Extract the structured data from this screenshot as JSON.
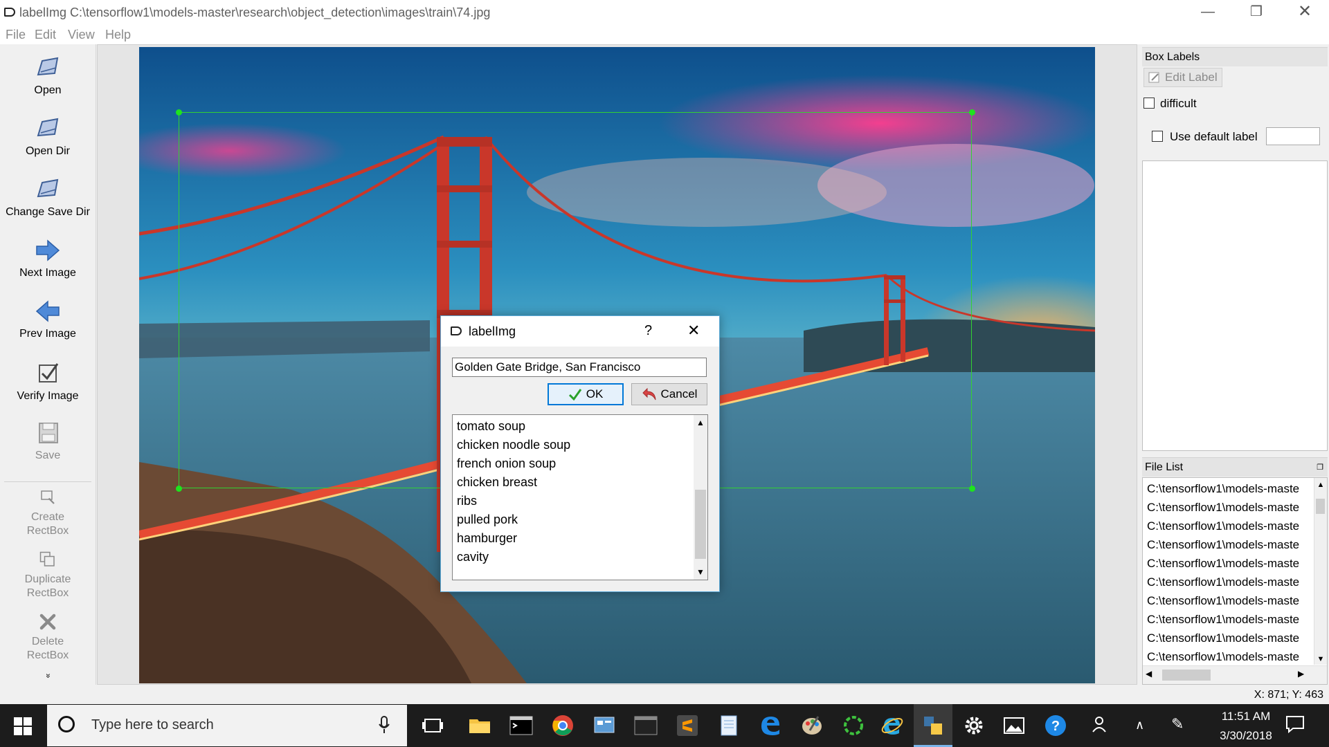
{
  "window": {
    "title": "labelImg C:\\tensorflow1\\models-master\\research\\object_detection\\images\\train\\74.jpg"
  },
  "menu": [
    "File",
    "Edit",
    "View",
    "Help"
  ],
  "toolbar": {
    "open": "Open",
    "open_dir": "Open Dir",
    "change_save_dir": "Change Save Dir",
    "next_image": "Next Image",
    "prev_image": "Prev Image",
    "verify_image": "Verify Image",
    "save": "Save",
    "create_rectbox": [
      "Create",
      "RectBox"
    ],
    "duplicate_rectbox": [
      "Duplicate",
      "RectBox"
    ],
    "delete_rectbox": [
      "Delete",
      "RectBox"
    ],
    "more": "»"
  },
  "box_labels": {
    "title": "Box Labels",
    "edit_label": "Edit Label",
    "difficult": "difficult",
    "use_default_label": "Use default label",
    "default_label_value": ""
  },
  "file_list": {
    "title": "File List",
    "items": [
      "C:\\tensorflow1\\models-maste",
      "C:\\tensorflow1\\models-maste",
      "C:\\tensorflow1\\models-maste",
      "C:\\tensorflow1\\models-maste",
      "C:\\tensorflow1\\models-maste",
      "C:\\tensorflow1\\models-maste",
      "C:\\tensorflow1\\models-maste",
      "C:\\tensorflow1\\models-maste",
      "C:\\tensorflow1\\models-maste",
      "C:\\tensorflow1\\models-maste"
    ]
  },
  "status": {
    "coords": "X: 871; Y: 463"
  },
  "dialog": {
    "title": "labelImg",
    "help": "?",
    "input_value": "Golden Gate Bridge, San Francisco",
    "ok": "OK",
    "cancel": "Cancel",
    "labels": [
      "tomato soup",
      "chicken noodle soup",
      "french onion soup",
      "chicken breast",
      "ribs",
      "pulled pork",
      "hamburger",
      "cavity"
    ]
  },
  "taskbar": {
    "search_placeholder": "Type here to search",
    "time": "11:51 AM",
    "date": "3/30/2018"
  },
  "colors": {
    "bbox": "#32d232",
    "handle": "#1ee31e",
    "dialog_border": "#5aa8d6",
    "ok_focus": "#0078d7",
    "taskbar": "#1c1c1c"
  }
}
